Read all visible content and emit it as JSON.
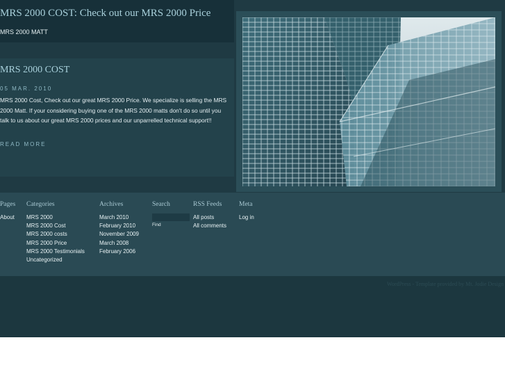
{
  "header": {
    "title": "MRS 2000 COST: Check out our MRS 2000 Price",
    "description": "MRS 2000 MATT"
  },
  "post": {
    "title": "MRS 2000 COST",
    "date": "05 MAR. 2010",
    "body": "MRS 2000 Cost, Check out our great MRS 2000 Price. We specialize is selling the MRS 2000 Matt. If your considering buying one of the MRS 2000 matts don't do so until you talk to us about our great MRS 2000 prices and our unparrelled technical support!!",
    "read_more": "READ MORE"
  },
  "footer": {
    "pages": {
      "heading": "Pages",
      "items": [
        "About"
      ]
    },
    "categories": {
      "heading": "Categories",
      "items": [
        "MRS 2000",
        "MRS 2000 Cost",
        "MRS 2000 costs",
        "MRS 2000 Price",
        "MRS 2000 Testimonials",
        "Uncategorized"
      ]
    },
    "archives": {
      "heading": "Archives",
      "items": [
        "March 2010",
        "February 2010",
        "November 2009",
        "March 2008",
        "February 2006"
      ]
    },
    "search": {
      "heading": "Search",
      "value": "",
      "button": "Find"
    },
    "rss": {
      "heading": "RSS Feeds",
      "items": [
        "All posts",
        "All comments"
      ]
    },
    "meta": {
      "heading": "Meta",
      "items": [
        "Log in"
      ]
    }
  },
  "credits": "WordPress - Template provided by Mt. Jodie Design",
  "colors": {
    "background": "#1f3a43",
    "header": "#173039",
    "footer": "#2a4a54",
    "link": "#a8d0db",
    "text": "#e6f0f2"
  },
  "photo_icon": "glass-skyscraper-image"
}
